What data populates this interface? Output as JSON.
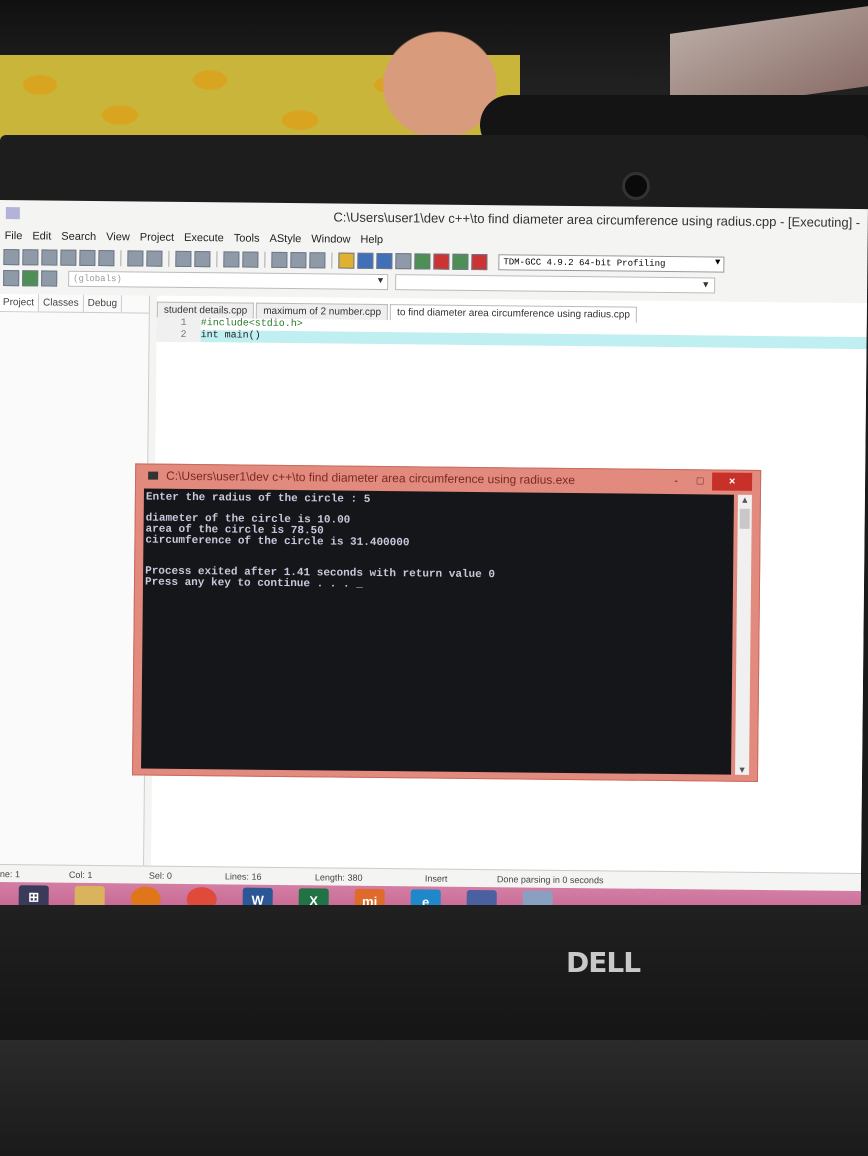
{
  "window": {
    "title": "C:\\Users\\user1\\dev c++\\to find diameter area circumference using radius.cpp - [Executing] -"
  },
  "menu": [
    "File",
    "Edit",
    "Search",
    "View",
    "Project",
    "Execute",
    "Tools",
    "AStyle",
    "Window",
    "Help"
  ],
  "toolbar": {
    "compiler": "TDM-GCC 4.9.2 64-bit Profiling",
    "scope": "(globals)"
  },
  "left_panel": {
    "tabs": [
      "Project",
      "Classes",
      "Debug"
    ]
  },
  "editor": {
    "tabs": [
      "student details.cpp",
      "maximum of 2 number.cpp",
      "to find diameter area circumference using radius.cpp"
    ],
    "active_tab": 2,
    "lines": [
      {
        "num": "1",
        "text": "#include<stdio.h>"
      },
      {
        "num": "2",
        "text": "int main()"
      }
    ]
  },
  "console": {
    "title": "C:\\Users\\user1\\dev c++\\to find diameter area circumference using radius.exe",
    "minimize": "-",
    "maximize": "□",
    "close": "×",
    "lines": [
      "Enter the radius of the circle : 5",
      "",
      "diameter of the circle is 10.00",
      "area of the circle is 78.50",
      "circumference of the circle is 31.400000",
      "",
      "",
      "Process exited after 1.41 seconds with return value 0",
      "Press any key to continue . . . _"
    ]
  },
  "statusbar": {
    "line_label": "Line:",
    "line_value": "1",
    "col_label": "Col:",
    "col_value": "1",
    "sel_label": "Sel:",
    "sel_value": "0",
    "lines_label": "Lines:",
    "lines_value": "16",
    "length_label": "Length:",
    "length_value": "380",
    "mode": "Insert",
    "message": "Done parsing in 0 seconds"
  },
  "taskbar": {
    "mi_label": "mi"
  },
  "laptop": {
    "brand": "DELL"
  }
}
